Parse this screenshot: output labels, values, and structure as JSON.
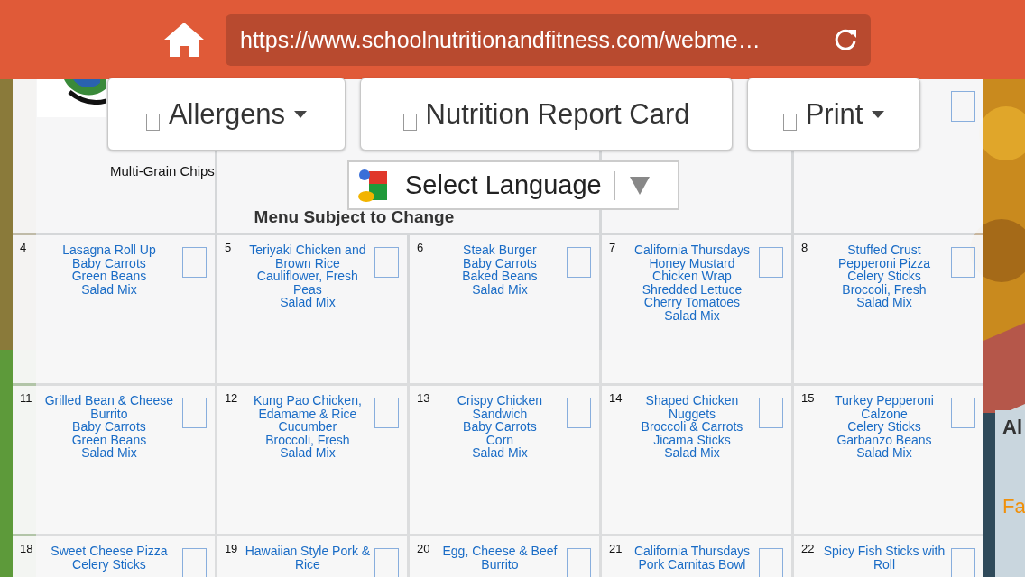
{
  "browser": {
    "url": "https://www.schoolnutritionandfitness.com/webme…"
  },
  "toolbar": [
    {
      "label": "Allergens",
      "checked": false,
      "has_menu": true
    },
    {
      "label": "Nutrition Report Card",
      "checked": false,
      "has_menu": false
    },
    {
      "label": "Print",
      "checked": false,
      "has_menu": true
    }
  ],
  "language": {
    "label": "Select Language"
  },
  "top_row": {
    "items": [
      "Multi-Grain Chips"
    ],
    "note": "Menu Subject to Change",
    "checked": false
  },
  "weeks": [
    [
      {
        "day": "4",
        "items": [
          "Lasagna Roll Up",
          "Baby Carrots",
          "Green Beans",
          "Salad Mix"
        ],
        "checked": false
      },
      {
        "day": "5",
        "items": [
          "Teriyaki Chicken and Brown Rice",
          "Cauliflower, Fresh Peas",
          "Salad Mix"
        ],
        "checked": false
      },
      {
        "day": "6",
        "items": [
          "Steak Burger",
          "Baby Carrots",
          "Baked Beans",
          "Salad Mix"
        ],
        "checked": false
      },
      {
        "day": "7",
        "items": [
          "California Thursdays",
          "Honey Mustard Chicken Wrap",
          "Shredded Lettuce",
          "Cherry Tomatoes",
          "Salad Mix"
        ],
        "checked": false
      },
      {
        "day": "8",
        "items": [
          "Stuffed Crust Pepperoni Pizza",
          "Celery Sticks",
          "Broccoli, Fresh",
          "Salad Mix"
        ],
        "checked": false
      }
    ],
    [
      {
        "day": "11",
        "items": [
          "Grilled Bean & Cheese Burrito",
          "Baby Carrots",
          "Green Beans",
          "Salad Mix"
        ],
        "checked": false
      },
      {
        "day": "12",
        "items": [
          "Kung Pao Chicken, Edamame & Rice",
          "Cucumber",
          "Broccoli, Fresh",
          "Salad Mix"
        ],
        "checked": false
      },
      {
        "day": "13",
        "items": [
          "Crispy Chicken Sandwich",
          "Baby Carrots",
          "Corn",
          "Salad Mix"
        ],
        "checked": false
      },
      {
        "day": "14",
        "items": [
          "Shaped Chicken Nuggets",
          "Broccoli & Carrots",
          "Jicama Sticks",
          "Salad Mix"
        ],
        "checked": false
      },
      {
        "day": "15",
        "items": [
          "Turkey Pepperoni Calzone",
          "Celery Sticks",
          "Garbanzo Beans",
          "Salad Mix"
        ],
        "checked": false
      }
    ],
    [
      {
        "day": "18",
        "items": [
          "Sweet Cheese Pizza",
          "Celery Sticks"
        ],
        "checked": false
      },
      {
        "day": "19",
        "items": [
          "Hawaiian Style Pork & Rice"
        ],
        "checked": false
      },
      {
        "day": "20",
        "items": [
          "Egg, Cheese & Beef Burrito"
        ],
        "checked": false
      },
      {
        "day": "21",
        "items": [
          "California Thursdays",
          "Pork Carnitas Bowl"
        ],
        "checked": false
      },
      {
        "day": "22",
        "items": [
          "Spicy Fish Sticks with Roll"
        ],
        "checked": false
      }
    ]
  ],
  "side_panel": {
    "heading": "Al",
    "link": "Fa"
  }
}
